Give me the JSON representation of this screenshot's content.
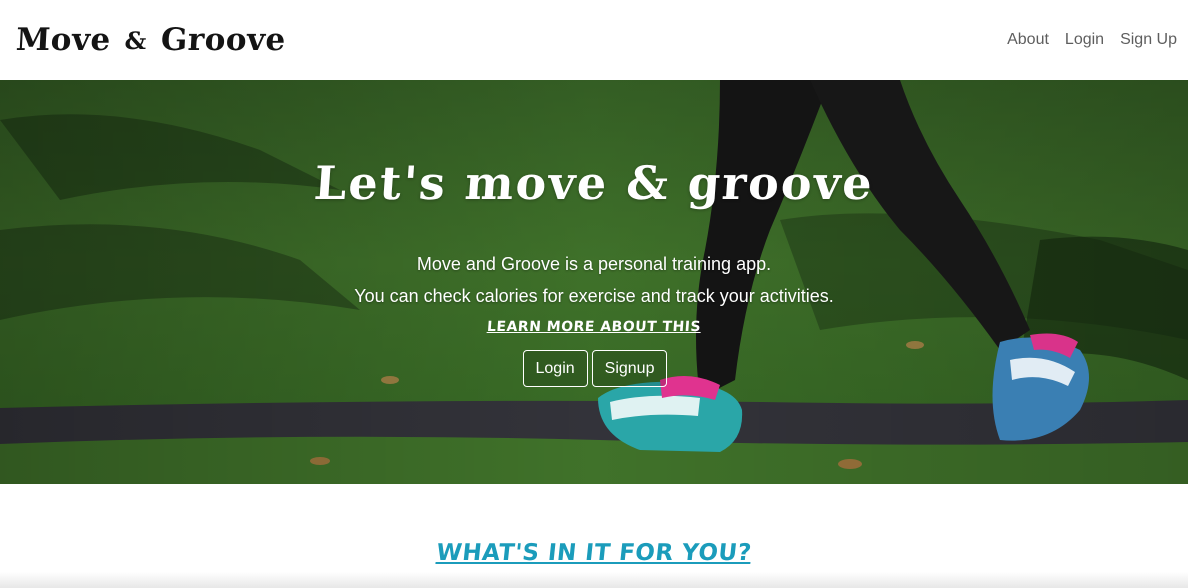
{
  "navbar": {
    "brand_left": "Move",
    "brand_amp": "&",
    "brand_right": "Groove",
    "links": [
      {
        "label": "About"
      },
      {
        "label": "Login"
      },
      {
        "label": "Sign Up"
      }
    ]
  },
  "hero": {
    "title": "Let's move & groove",
    "line1": "Move and Groove is a personal training app.",
    "line2": "You can check calories for exercise and track your activities.",
    "learn_more": "LEARN MORE ABOUT THIS",
    "login_button": "Login",
    "signup_button": "Signup"
  },
  "section": {
    "title": "WHAT'S IN IT FOR YOU?"
  },
  "colors": {
    "accent": "#1b9cbb",
    "grass": "#4f8a33",
    "path": "#3c3c44"
  }
}
